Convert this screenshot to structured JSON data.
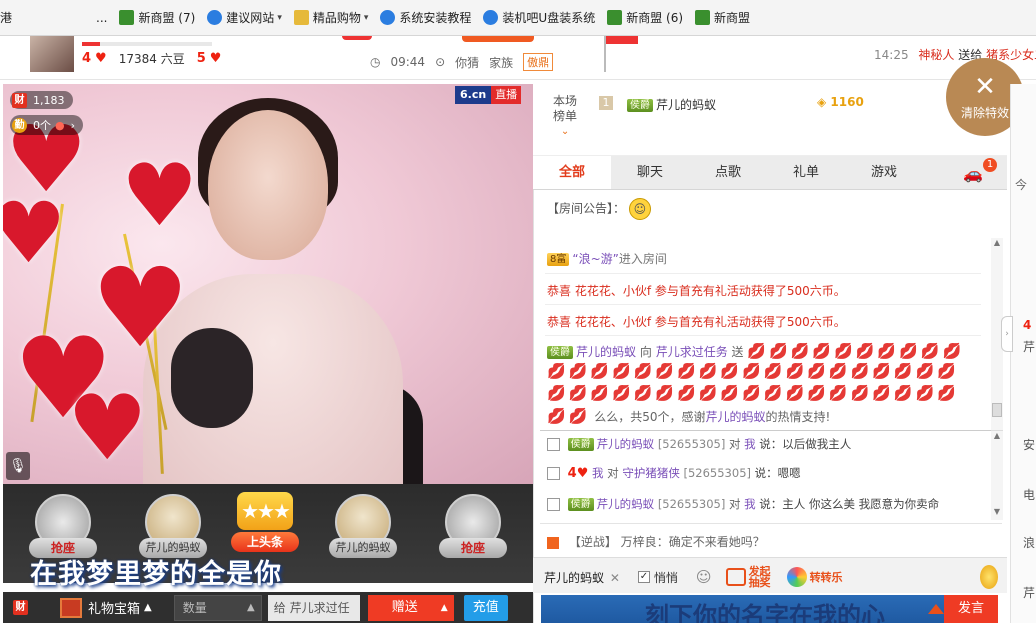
{
  "bookmarks": [
    {
      "label": "港",
      "icon": "none"
    },
    {
      "label": "...",
      "icon": "none"
    },
    {
      "label": "新商盟 (7)",
      "icon": "green-leaf-icon"
    },
    {
      "label": "建议网站",
      "icon": "ie-icon",
      "dropdown": "▾"
    },
    {
      "label": "精品购物",
      "icon": "folder-icon",
      "dropdown": "▾"
    },
    {
      "label": "系统安装教程",
      "icon": "ie-icon"
    },
    {
      "label": "装机吧U盘装系统",
      "icon": "ie-icon"
    },
    {
      "label": "新商盟 (6)",
      "icon": "green-leaf-icon"
    },
    {
      "label": "新商盟",
      "icon": "green-leaf-icon"
    }
  ],
  "topstrip": {
    "host_hearts_left": "4",
    "host_beans": "17384 六豆",
    "host_hearts_right": "5",
    "time_now": "09:44",
    "guess_label": "你猜",
    "family_label": "家族",
    "family_badge": "傲鼎",
    "marquee_time": "14:25",
    "marquee_user": "神秘人",
    "marquee_text": "送给",
    "marquee_target": "猪系少女二"
  },
  "video": {
    "cai_label": "财",
    "cai_count": "1,183",
    "qin_label": "勤",
    "qin_count": "0个",
    "logo": "6.cn",
    "live_label": "直播",
    "mic_icon": "microphone-icon"
  },
  "seats": [
    {
      "label": "抢座",
      "type": "empty"
    },
    {
      "label": "芹儿的蚂蚁",
      "type": "user"
    },
    {
      "label": "上头条",
      "type": "headline"
    },
    {
      "label": "芹儿的蚂蚁",
      "type": "user"
    },
    {
      "label": "抢座",
      "type": "empty"
    }
  ],
  "lyric": "在我梦里梦的全是你",
  "giftbar": {
    "cai": "财",
    "box_label": "礼物宝箱",
    "qty_placeholder": "数量",
    "to_prefix": "给",
    "to_target": "芹儿求过任",
    "send_label": "赠送",
    "charge_label": "充值"
  },
  "rank": {
    "title_line1": "本场",
    "title_line2": "榜单",
    "rank_no": "1",
    "vip": "侯爵",
    "user": "芹儿的蚂蚁",
    "score": "1160"
  },
  "clear_fx": {
    "icon": "close-icon",
    "label": "清除特效"
  },
  "tabs": [
    {
      "label": "全部",
      "active": true
    },
    {
      "label": "聊天",
      "active": false
    },
    {
      "label": "点歌",
      "active": false
    },
    {
      "label": "礼单",
      "active": false
    },
    {
      "label": "游戏",
      "active": false
    }
  ],
  "car_badge": "1",
  "notice": {
    "label": "【房间公告】：",
    "emoji": "grin-emoji-icon"
  },
  "chat": {
    "enter": {
      "vip": "8富",
      "user": "“浪~游”",
      "text": "进入房间"
    },
    "congrats": [
      {
        "prefix": "恭喜",
        "users": "花花花、小伙f",
        "text": "参与首充有礼活动获得了500六币。"
      },
      {
        "prefix": "恭喜",
        "users": "花花花、小伙f",
        "text": "参与首充有礼活动获得了500六币。"
      }
    ],
    "gift": {
      "vip": "侯爵",
      "from": "芹儿的蚂蚁",
      "to_word": "向",
      "to": "芹儿求过任务",
      "send_word": "送",
      "lips_row1": "💋💋💋💋💋💋💋💋💋💋",
      "lips_row2": "💋💋💋💋💋💋💋💋💋💋💋💋💋💋💋💋💋💋💋",
      "lips_row3": "💋💋💋💋💋💋💋💋💋💋💋💋💋💋💋💋💋💋💋",
      "lips_row4": "💋💋",
      "tail_a": "么么，共50个，感谢",
      "tail_user": "芹儿的蚂蚁",
      "tail_b": "的热情支持!"
    }
  },
  "private": [
    {
      "vip": "侯爵",
      "user": "芹儿的蚂蚁",
      "id": "[52655305]",
      "to_word": "对",
      "to": "我",
      "say": "说：以后做我主人"
    },
    {
      "vip": "4",
      "user": "我",
      "id": "",
      "to_word": "对",
      "to": "守护猪猪侠",
      "say_id": "[52655305]",
      "say": "说：嗯嗯"
    },
    {
      "vip": "侯爵",
      "user": "芹儿的蚂蚁",
      "id": "[52655305]",
      "to_word": "对",
      "to": "我",
      "say": "说：主人 你这么美 我愿意为你卖命"
    }
  ],
  "broadcast": {
    "tag": "【逆战】",
    "user": "万梓良",
    "text": "：确定不来看她吗？"
  },
  "input": {
    "target": "芹儿的蚂蚁",
    "whisper_label": "悄悄",
    "lottery_label": "发起抽奖",
    "wheel_label": "转转乐",
    "draft_text": "刻下你的名字在我的心",
    "send_label": "发言"
  },
  "right_edge": [
    "今",
    "4",
    "芹",
    "安",
    "电",
    "浪",
    "芹"
  ]
}
